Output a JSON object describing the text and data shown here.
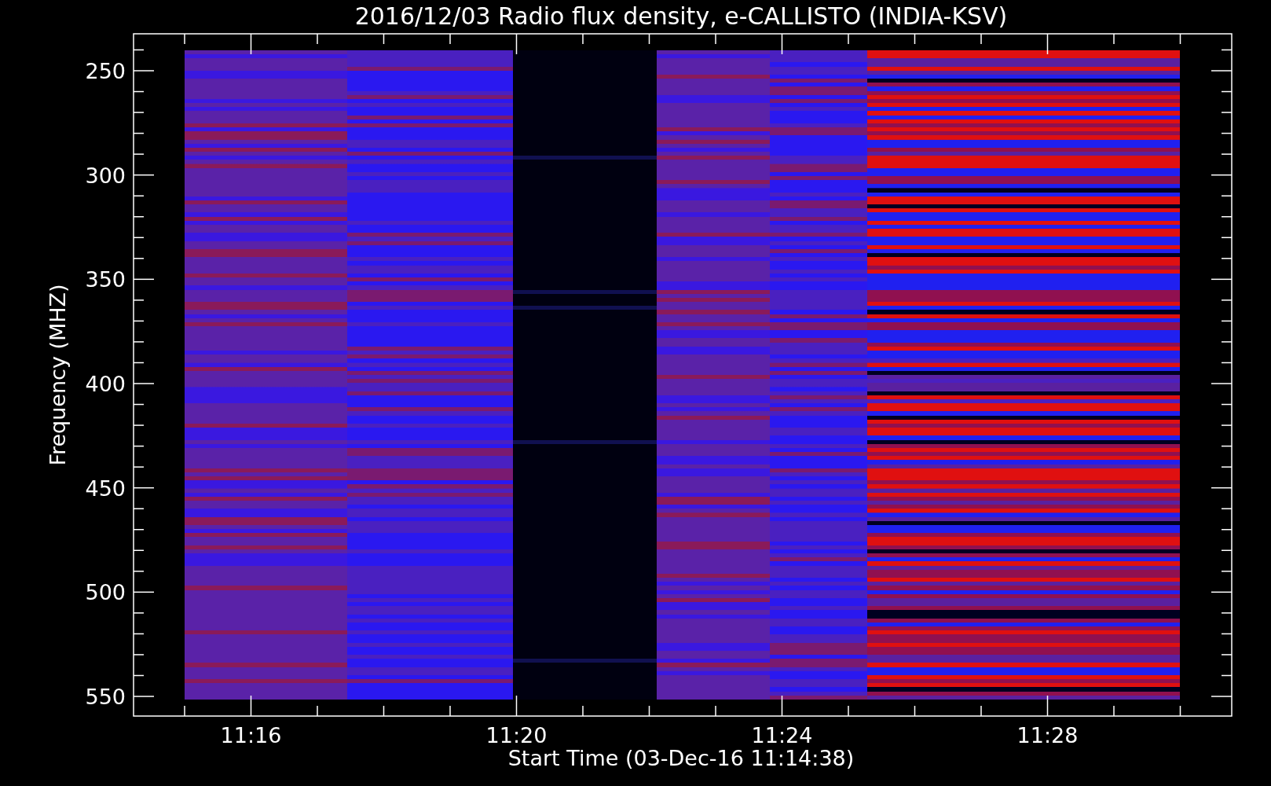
{
  "title": "2016/12/03  Radio flux density, e-CALLISTO (INDIA-KSV)",
  "ylabel": "Frequency (MHZ)",
  "xlabel": "Start Time (03-Dec-16 11:14:38)",
  "y_tick_labels": [
    "250",
    "300",
    "350",
    "400",
    "450",
    "500",
    "550"
  ],
  "x_tick_labels": [
    "11:16",
    "11:20",
    "11:24",
    "11:28"
  ]
}
